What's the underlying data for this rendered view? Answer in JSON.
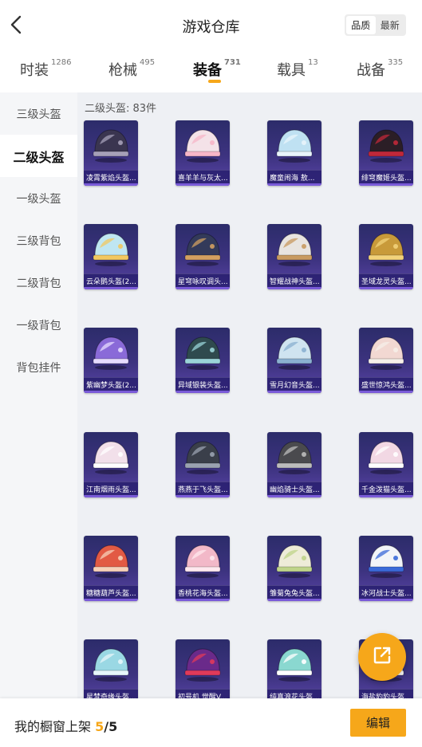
{
  "header": {
    "title": "游戏仓库",
    "sort_options": [
      "品质",
      "最新"
    ],
    "sort_selected": "品质"
  },
  "tabs": [
    {
      "label": "时装",
      "count": "1286"
    },
    {
      "label": "枪械",
      "count": "495"
    },
    {
      "label": "装备",
      "count": "731",
      "active": true
    },
    {
      "label": "载具",
      "count": "13"
    },
    {
      "label": "战备",
      "count": "335"
    }
  ],
  "sidebar": {
    "items": [
      {
        "label": "三级头盔"
      },
      {
        "label": "二级头盔",
        "active": true
      },
      {
        "label": "一级头盔"
      },
      {
        "label": "三级背包"
      },
      {
        "label": "二级背包"
      },
      {
        "label": "一级背包"
      },
      {
        "label": "背包挂件"
      }
    ]
  },
  "section": {
    "title": "二级头盔: 83件"
  },
  "items": [
    {
      "name": "凌霄紫焰头盔...",
      "color": "#3a3550",
      "accent": "#a6a0b8"
    },
    {
      "name": "喜羊羊与灰太...",
      "color": "#f4e2e8",
      "accent": "#f7b6c8"
    },
    {
      "name": "魔童闹海 敖...",
      "color": "#bfe1f2",
      "accent": "#e8f4fb"
    },
    {
      "name": "绯穹魔姬头盔...",
      "color": "#2b1e26",
      "accent": "#c0283a"
    },
    {
      "name": "云朵鹅头盔(2...",
      "color": "#bfe6f2",
      "accent": "#f2c860"
    },
    {
      "name": "星穹咏叹调头...",
      "color": "#333a5a",
      "accent": "#d2a060"
    },
    {
      "name": "智耀战神头盔...",
      "color": "#e8e4e0",
      "accent": "#c89a60"
    },
    {
      "name": "圣域龙灵头盔...",
      "color": "#c89a3a",
      "accent": "#f2d27a"
    },
    {
      "name": "紫幽梦头盔(2...",
      "color": "#8a6ad8",
      "accent": "#e6dbff"
    },
    {
      "name": "异域银装头盔...",
      "color": "#2f4a4e",
      "accent": "#9ad4d8"
    },
    {
      "name": "雪月幻音头盔...",
      "color": "#cfe4f0",
      "accent": "#8ab0d0"
    },
    {
      "name": "盛世惊鸿头盔...",
      "color": "#f2d8d2",
      "accent": "#f6efe8"
    },
    {
      "name": "江南烟雨头盔...",
      "color": "#f2e0ea",
      "accent": "#ffffff"
    },
    {
      "name": "燕燕于飞头盔...",
      "color": "#3a3f4a",
      "accent": "#9aa2b0"
    },
    {
      "name": "幽焰骑士头盔...",
      "color": "#4a4a4e",
      "accent": "#bcbcbc"
    },
    {
      "name": "千金泼猫头盔...",
      "color": "#f2d8e4",
      "accent": "#ffffff"
    },
    {
      "name": "糖糖葫芦头盔...",
      "color": "#e25a44",
      "accent": "#f6d0b8"
    },
    {
      "name": "香桃花海头盔...",
      "color": "#f2b8c8",
      "accent": "#ffe8ee"
    },
    {
      "name": "雏菊兔兔头盔...",
      "color": "#eeecd8",
      "accent": "#bfd48a"
    },
    {
      "name": "冰河战士头盔...",
      "color": "#f2f4f8",
      "accent": "#3a6ad8"
    },
    {
      "name": "星梦奇缘头盔...",
      "color": "#9ad8e4",
      "accent": "#e6f6fa"
    },
    {
      "name": "初号机 觉醒V...",
      "color": "#6a2a8a",
      "accent": "#e03a5a"
    },
    {
      "name": "纯真浪花头盔...",
      "color": "#8ad8d0",
      "accent": "#ffffff"
    },
    {
      "name": "海盐豹豹头盔...",
      "color": "#cfe8f4",
      "accent": "#ffffff"
    }
  ],
  "footer": {
    "label": "我的橱窗上架",
    "current": "5",
    "separator": "/",
    "max": "5",
    "edit_label": "编辑"
  },
  "colors": {
    "accent": "#f6a71a",
    "card_bg": "#3d3380"
  }
}
